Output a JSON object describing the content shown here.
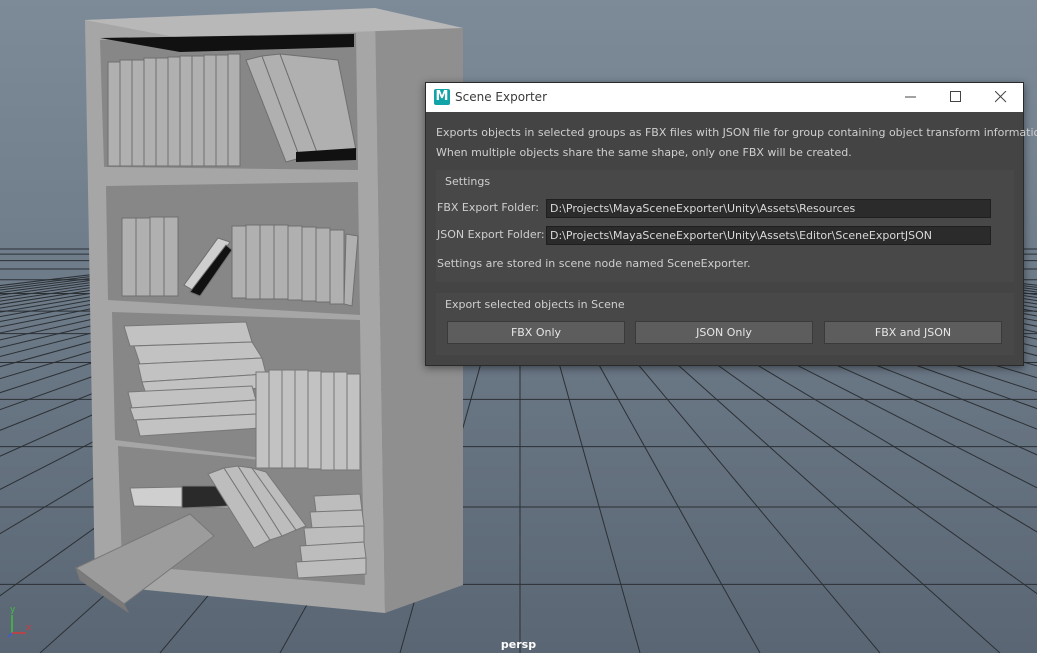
{
  "viewport": {
    "camera_label": "persp",
    "axis_x": "x",
    "axis_y": "y",
    "colors": {
      "sky_top": "#7d8b99",
      "sky_bottom": "#5d6b79",
      "grid_line": "#2b3035",
      "mesh": "#a9a9a9"
    }
  },
  "dialog": {
    "title": "Scene Exporter",
    "app_icon_letter": "M",
    "description_line1": "Exports objects in selected groups as FBX files with JSON file for group containing object transform information.",
    "description_line2": "When multiple objects share the same shape, only one FBX will be created.",
    "settings": {
      "group_title": "Settings",
      "fbx_label": "FBX Export Folder:",
      "fbx_value": "D:\\Projects\\MayaSceneExporter\\Unity\\Assets\\Resources",
      "json_label": "JSON Export Folder:",
      "json_value": "D:\\Projects\\MayaSceneExporter\\Unity\\Assets\\Editor\\SceneExportJSON",
      "note": "Settings are stored in scene node named SceneExporter."
    },
    "export": {
      "group_title": "Export selected objects in Scene",
      "fbx_only": "FBX Only",
      "json_only": "JSON Only",
      "fbx_and_json": "FBX and JSON"
    },
    "colors": {
      "body": "#444444",
      "title_bar": "#ffffff",
      "maya_accent": "#10a3a7",
      "button": "#5d5d5d"
    }
  }
}
